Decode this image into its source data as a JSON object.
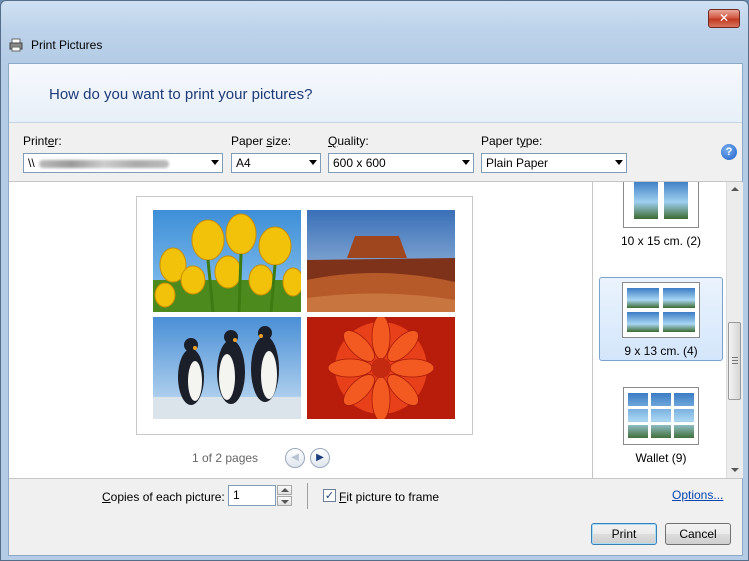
{
  "window": {
    "title": "Print Pictures",
    "close_label": "✕"
  },
  "header": {
    "question": "How do you want to print your pictures?"
  },
  "options": {
    "printer": {
      "label_pre": "Print",
      "label_key": "e",
      "label_post": "r:",
      "value": "\\\\"
    },
    "paper_size": {
      "label_pre": "Paper ",
      "label_key": "s",
      "label_post": "ize:",
      "value": "A4"
    },
    "quality": {
      "label_pre": "",
      "label_key": "Q",
      "label_post": "uality:",
      "value": "600 x 600"
    },
    "paper_type": {
      "label_pre": "Paper t",
      "label_key": "y",
      "label_post": "pe:",
      "value": "Plain Paper"
    },
    "help_label": "?"
  },
  "preview": {
    "page_indicator": "1 of 2 pages",
    "prev_icon": "◀",
    "next_icon": "▶"
  },
  "layouts": [
    {
      "label": "10 x 15 cm. (2)",
      "selected": false
    },
    {
      "label": "9 x 13 cm. (4)",
      "selected": true
    },
    {
      "label": "Wallet (9)",
      "selected": false
    }
  ],
  "bottom": {
    "copies_label_key": "C",
    "copies_label_rest": "opies of each picture:",
    "copies_value": "1",
    "fit_checked_mark": "✓",
    "fit_label_key": "F",
    "fit_label_rest": "it picture to frame",
    "options_link": "Options..."
  },
  "footer": {
    "print_label": "Print",
    "cancel_label": "Cancel"
  }
}
